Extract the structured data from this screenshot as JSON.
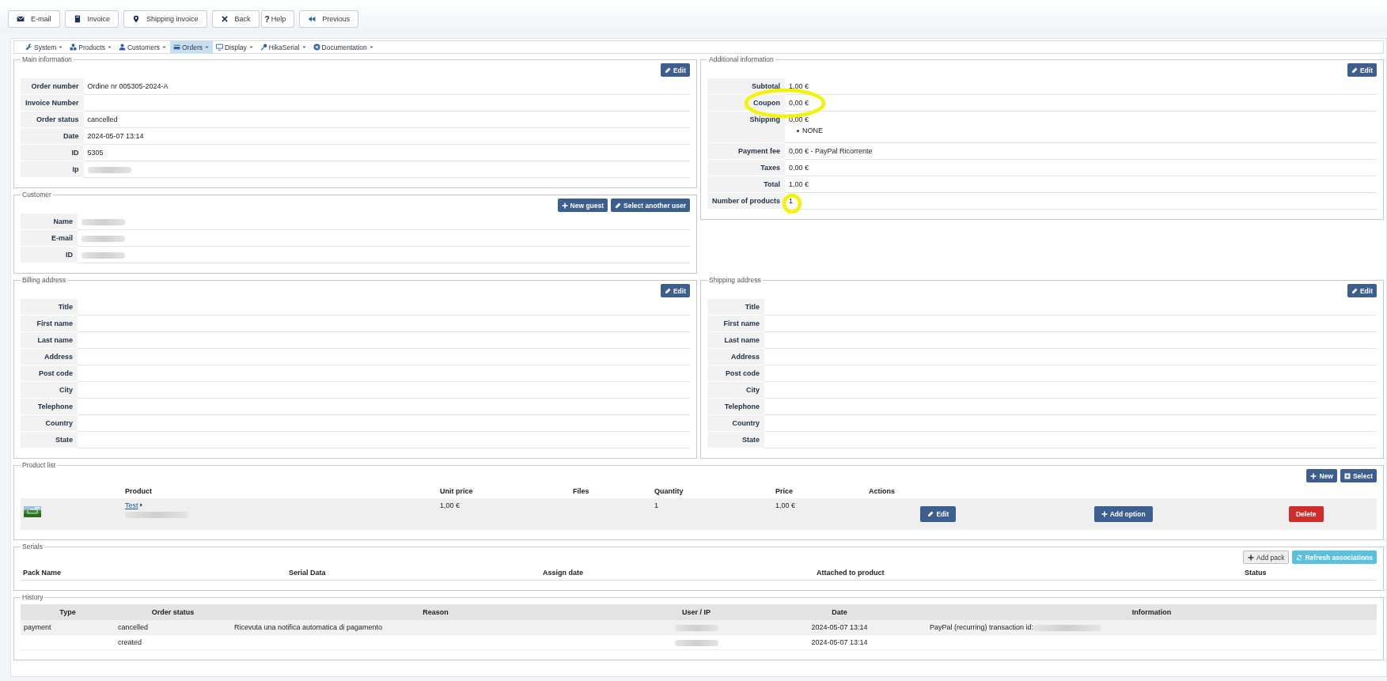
{
  "toolbar": [
    {
      "label": "E-mail"
    },
    {
      "label": "Invoice"
    },
    {
      "label": "Shipping invoice"
    },
    {
      "label": "Back"
    },
    {
      "icon_glyph": "?",
      "label": "Help"
    },
    {
      "label": "Previous"
    }
  ],
  "menu": [
    {
      "label": "System",
      "selected": false
    },
    {
      "label": "Products",
      "selected": false
    },
    {
      "label": "Customers",
      "selected": false
    },
    {
      "label": "Orders",
      "selected": true
    },
    {
      "label": "Display",
      "selected": false
    },
    {
      "label": "HikaSerial",
      "selected": false
    },
    {
      "label": "Documentation",
      "selected": false
    }
  ],
  "main_information": {
    "legend": "Main information",
    "buttons": [
      {
        "label": "Edit"
      }
    ],
    "rows": [
      {
        "label": "Order number",
        "value": "Ordine nr 005305-2024-A"
      },
      {
        "label": "Invoice Number"
      },
      {
        "label": "Order status",
        "value": "cancelled"
      },
      {
        "label": "Date",
        "value": "2024-05-07 13:14"
      },
      {
        "label": "ID",
        "value": "5305"
      },
      {
        "label": "Ip",
        "redacted": true
      }
    ]
  },
  "customer": {
    "legend": "Customer",
    "buttons": [
      {
        "label": "New guest"
      },
      {
        "label": "Select another user"
      }
    ],
    "rows": [
      {
        "label": "Name",
        "redacted": true
      },
      {
        "label": "E-mail",
        "redacted": true
      },
      {
        "label": "ID",
        "redacted": true
      }
    ]
  },
  "additional_information": {
    "legend": "Additional information",
    "buttons": [
      {
        "label": "Edit"
      }
    ],
    "rows": [
      {
        "label": "Subtotal",
        "value": "1,00 €"
      },
      {
        "label": "Coupon",
        "value": "0,00 €",
        "highlighted": true
      },
      {
        "label": "Shipping",
        "value": "0,00 €",
        "sub": [
          "NONE"
        ]
      },
      {
        "label": "Payment fee",
        "value": "0,00 € - PayPal Ricorrente"
      },
      {
        "label": "Taxes",
        "value": "0,00 €"
      },
      {
        "label": "Total",
        "value": "1,00 €"
      },
      {
        "label": "Number of products",
        "value": "1",
        "highlighted": true
      }
    ]
  },
  "billing_address": {
    "legend": "Billing address",
    "buttons": [
      {
        "label": "Edit"
      }
    ],
    "rows": [
      {
        "label": "Title"
      },
      {
        "label": "First name"
      },
      {
        "label": "Last name"
      },
      {
        "label": "Address"
      },
      {
        "label": "Post code"
      },
      {
        "label": "City"
      },
      {
        "label": "Telephone"
      },
      {
        "label": "Country"
      },
      {
        "label": "State"
      }
    ]
  },
  "shipping_address": {
    "legend": "Shipping address",
    "buttons": [
      {
        "label": "Edit"
      }
    ],
    "rows": [
      {
        "label": "Title"
      },
      {
        "label": "First name"
      },
      {
        "label": "Last name"
      },
      {
        "label": "Address"
      },
      {
        "label": "Post code"
      },
      {
        "label": "City"
      },
      {
        "label": "Telephone"
      },
      {
        "label": "Country"
      },
      {
        "label": "State"
      }
    ]
  },
  "product_list": {
    "legend": "Product list",
    "buttons": [
      {
        "label": "New"
      },
      {
        "label": "Select"
      }
    ],
    "columns": [
      "Product",
      "Unit price",
      "Files",
      "Quantity",
      "Price",
      "Actions"
    ],
    "rows": [
      {
        "product": "Test",
        "code_redacted": true,
        "unit_price": "1,00 €",
        "quantity": "1",
        "price": "1,00 €",
        "actions": [
          {
            "kind": "edit",
            "label": "Edit"
          },
          {
            "kind": "add",
            "label": "Add option"
          },
          {
            "kind": "delete",
            "label": "Delete"
          }
        ]
      }
    ]
  },
  "serials": {
    "legend": "Serials",
    "buttons": [
      {
        "kind": "plain",
        "label": "Add pack"
      },
      {
        "kind": "info",
        "label": "Refresh associations"
      }
    ],
    "columns": [
      "Pack Name",
      "Serial Data",
      "Assign date",
      "Attached to product",
      "Status"
    ]
  },
  "history": {
    "legend": "History",
    "columns": [
      "Type",
      "Order status",
      "Reason",
      "User / IP",
      "Date",
      "Information"
    ],
    "rows": [
      {
        "type": "payment",
        "order_status": "cancelled",
        "reason": "Ricevuta una notifica automatica di pagamento",
        "user_redacted": true,
        "date": "2024-05-07 13:14",
        "information": "PayPal (recurring) transaction id:",
        "information_redacted": true
      },
      {
        "order_status": "created",
        "user_redacted": true,
        "date": "2024-05-07 13:14"
      }
    ]
  }
}
